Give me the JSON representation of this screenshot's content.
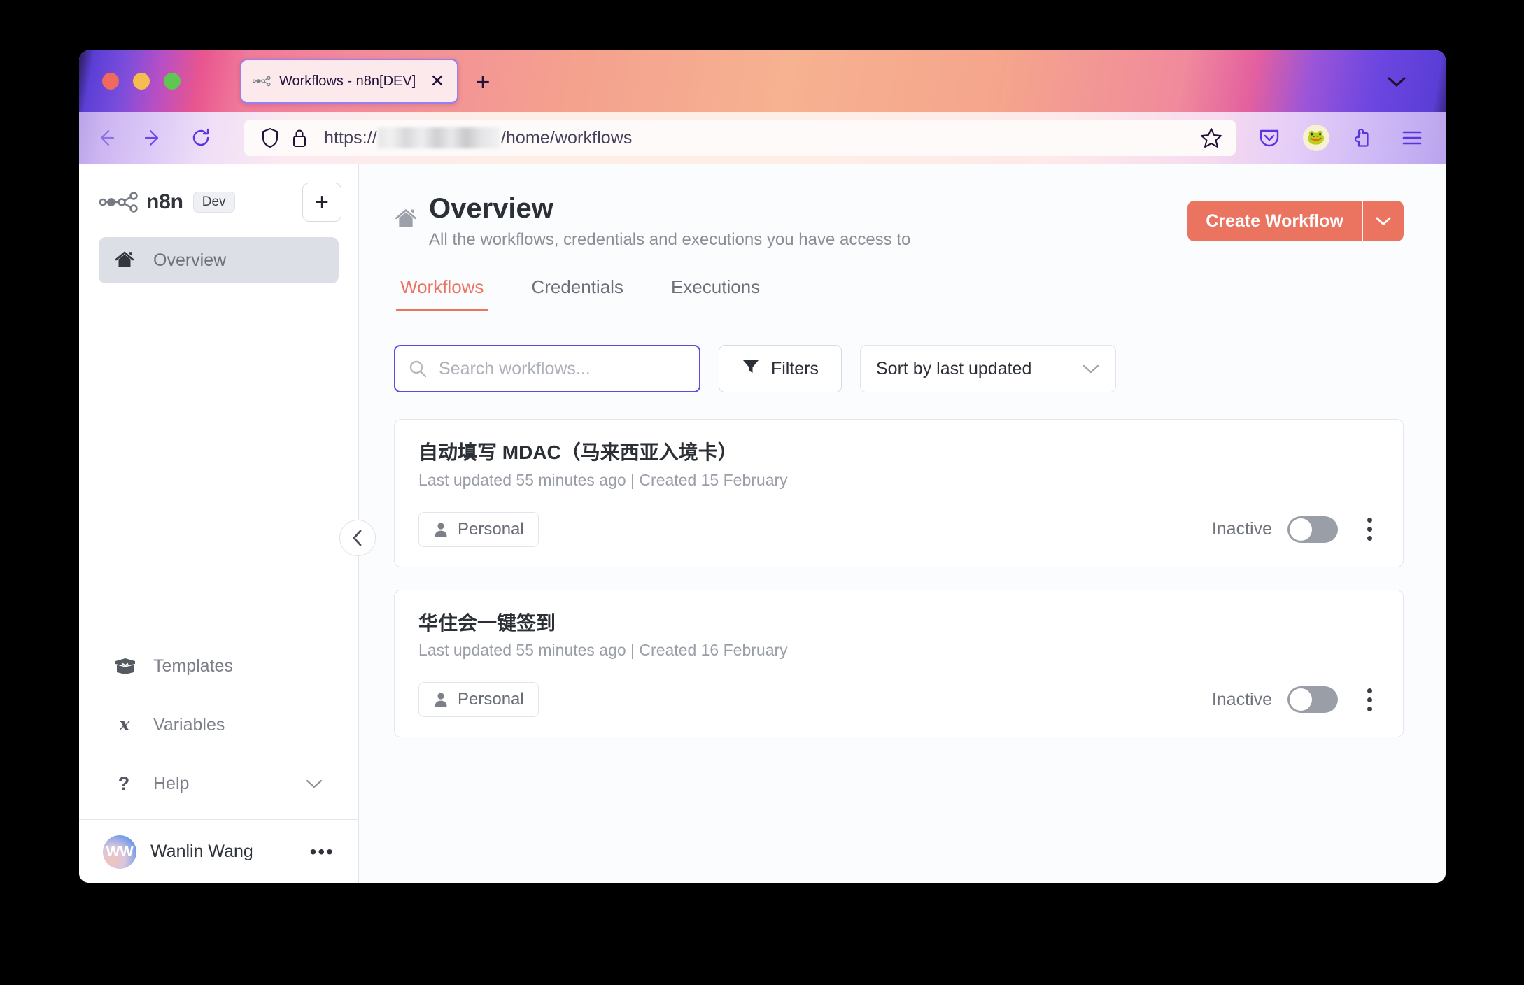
{
  "browser": {
    "tab": {
      "title": "Workflows - n8n[DEV]",
      "favicon_icon": "n8n-nodes-icon",
      "close_icon": "close-icon"
    },
    "new_tab_icon": "plus-icon",
    "tab_list_icon": "chevron-down-icon",
    "toolbar": {
      "back_icon": "arrow-left-icon",
      "forward_icon": "arrow-right-icon",
      "reload_icon": "reload-icon",
      "shield_icon": "shield-icon",
      "lock_icon": "lock-icon",
      "bookmark_icon": "star-icon",
      "pocket_icon": "pocket-icon",
      "account_icon": "extension-avatar-icon",
      "extensions_icon": "puzzle-icon",
      "menu_icon": "hamburger-menu-icon"
    },
    "url": {
      "scheme": "https://",
      "domain_redacted": true,
      "path": "/home/workflows"
    }
  },
  "sidebar": {
    "brand": {
      "logo_icon": "n8n-nodes-icon",
      "wordmark": "n8n",
      "badge": "Dev"
    },
    "add_button_label": "+",
    "primary_items": [
      {
        "label": "Overview",
        "icon": "home-icon",
        "active": true
      }
    ],
    "secondary_items": [
      {
        "label": "Templates",
        "icon": "box-icon",
        "chevron": false
      },
      {
        "label": "Variables",
        "icon": "variable-x-icon",
        "chevron": false
      },
      {
        "label": "Help",
        "icon": "question-mark-icon",
        "chevron": true
      }
    ],
    "user": {
      "initials": "WW",
      "name": "Wanlin Wang",
      "menu_icon": "ellipsis-icon"
    },
    "collapse_icon": "chevron-left-icon"
  },
  "main": {
    "header": {
      "home_icon": "home-icon",
      "title": "Overview",
      "subtitle": "All the workflows, credentials and executions you have access to",
      "create_button_label": "Create Workflow",
      "create_button_caret_icon": "chevron-down-icon",
      "accent_color": "#eb7461"
    },
    "tabs": [
      {
        "label": "Workflows",
        "active": true
      },
      {
        "label": "Credentials",
        "active": false
      },
      {
        "label": "Executions",
        "active": false
      }
    ],
    "controls": {
      "search_placeholder": "Search workflows...",
      "search_value": "",
      "search_icon": "search-icon",
      "search_focused": true,
      "filters_label": "Filters",
      "filters_icon": "funnel-icon",
      "sort_value": "Sort by last updated",
      "sort_caret_icon": "chevron-down-icon"
    },
    "workflows": [
      {
        "title": "自动填写 MDAC（马来西亚入境卡）",
        "meta": "Last updated 55 minutes ago | Created 15 February",
        "project_badge": "Personal",
        "project_icon": "person-icon",
        "status_label": "Inactive",
        "active": false,
        "menu_icon": "kebab-menu-icon"
      },
      {
        "title": "华住会一键签到",
        "meta": "Last updated 55 minutes ago | Created 16 February",
        "project_badge": "Personal",
        "project_icon": "person-icon",
        "status_label": "Inactive",
        "active": false,
        "menu_icon": "kebab-menu-icon"
      }
    ]
  }
}
